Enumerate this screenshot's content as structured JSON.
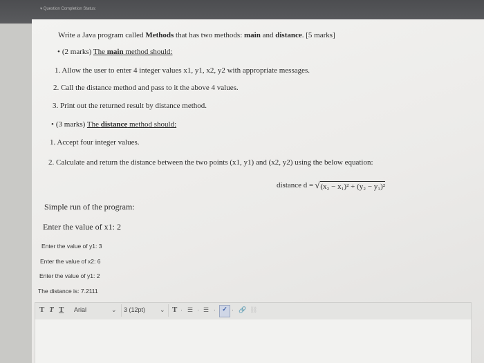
{
  "header": {
    "status_label": "▾ Question Completion Status:"
  },
  "question": {
    "intro_pre": "Write a Java program called ",
    "intro_methods": "Methods",
    "intro_mid": " that has two methods: ",
    "intro_main": "main",
    "intro_and": " and ",
    "intro_distance": "distance",
    "intro_marks": ". [5 marks]",
    "section1_pre": "(2 marks) ",
    "section1_title_a": "The ",
    "section1_title_b": "main",
    "section1_title_c": " method should:",
    "item1": "1. Allow the user to enter 4 integer values x1, y1, x2, y2 with appropriate messages.",
    "item2": "2. Call the distance method and pass to it the above 4 values.",
    "item3": "3. Print out the returned result by distance method.",
    "section2_pre": "(3 marks) ",
    "section2_title_a": "The ",
    "section2_title_b": "distance",
    "section2_title_c": " method should:",
    "item4": "1. Accept four integer values.",
    "item5": "2. Calculate and return the distance between the two points (x1, y1) and (x2, y2) using the below equation:",
    "equation_lhs": "distance d =",
    "equation_rhs": "(x₂ − x₁)² + (y₂ − y₁)²"
  },
  "sample_run": {
    "title": "Simple run of the program:",
    "line1": "Enter the value of x1: 2",
    "line2": "Enter the value of y1: 3",
    "line3": "Enter the value of x2: 6",
    "line4": "Enter the value of y1: 2",
    "line5": "The distance is: 7.2111"
  },
  "toolbar": {
    "bold": "T",
    "italic": "T",
    "underline": "T",
    "font_family": "Arial",
    "font_size": "3 (12pt)",
    "dropdown_arrow": "✓",
    "text_color": "T",
    "list_bullets": "☰",
    "list_numbers": "☰",
    "spellcheck": "✓",
    "link": "🔗",
    "unlink": "⛓"
  }
}
